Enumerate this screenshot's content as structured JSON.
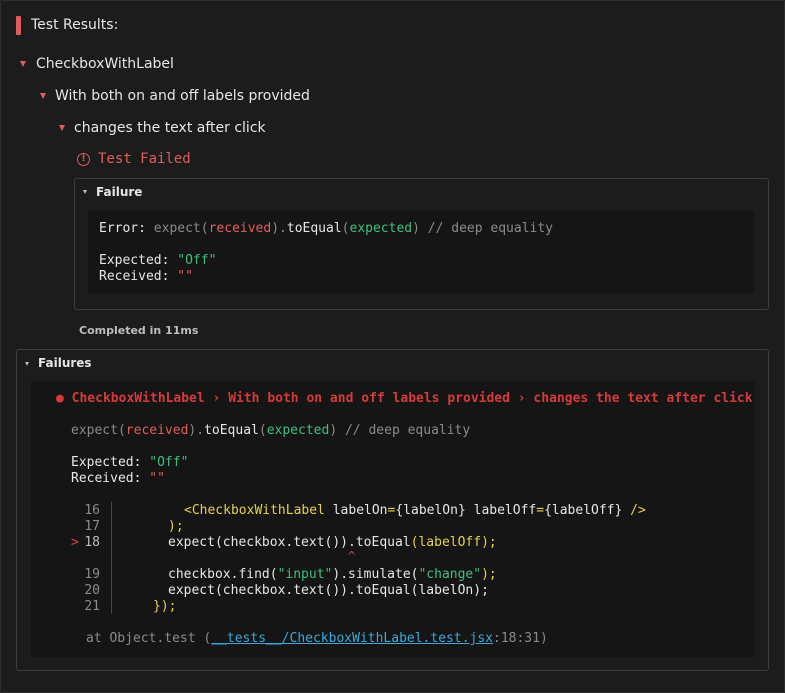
{
  "header": {
    "title": "Test Results:"
  },
  "tree": {
    "suite": "CheckboxWithLabel",
    "group": "With both on and off labels provided",
    "test": "changes the text after click"
  },
  "test_status": {
    "icon": "exclamation-circle-icon",
    "label": "Test Failed"
  },
  "failure_panel": {
    "title": "Failure",
    "error_prefix": "Error: ",
    "error_expect": "expect(",
    "error_received": "received",
    "error_close1": ").",
    "error_toEqual": "toEqual",
    "error_open2": "(",
    "error_expected": "expected",
    "error_close2": ")",
    "error_comment": " // deep equality",
    "expected_label": "Expected: ",
    "expected_value": "\"Off\"",
    "received_label": "Received: ",
    "received_value": "\"\""
  },
  "completed": "Completed in 11ms",
  "failures_panel": {
    "title": "Failures",
    "bullet": "●",
    "breadcrumb": "CheckboxWithLabel › With both on and off labels provided › changes the text after click",
    "code": {
      "l16_no": "16",
      "l17_no": "17",
      "l18_marker": ">",
      "l18_no": "18",
      "l19_no": "19",
      "l20_no": "20",
      "l21_no": "21",
      "l16_a": "<CheckboxWithLabel",
      "l16_b": " labelOn",
      "l16_c": "=",
      "l16_d": "{labelOn}",
      "l16_e": " labelOff",
      "l16_f": "=",
      "l16_g": "{labelOff}",
      "l16_h": " />",
      "l17": ");",
      "l18_a": "expect(checkbox.text()).",
      "l18_b": "toEqual",
      "l18_c": "(labelOff);",
      "caret": "^",
      "l19_a": "checkbox.find(",
      "l19_b": "\"input\"",
      "l19_c": ").simulate(",
      "l19_d": "\"change\"",
      "l19_e": ");",
      "l20": "expect(checkbox.text()).toEqual(labelOn);",
      "l21": "});"
    },
    "stack_prefix": "at Object.test (",
    "stack_file": "__tests__/CheckboxWithLabel.test.jsx",
    "stack_suffix": ":18:31)"
  },
  "colors": {
    "accent": "#e05d5d",
    "green": "#3fbf7f",
    "yellow": "#e2d24b",
    "blue": "#3ba9d9"
  }
}
